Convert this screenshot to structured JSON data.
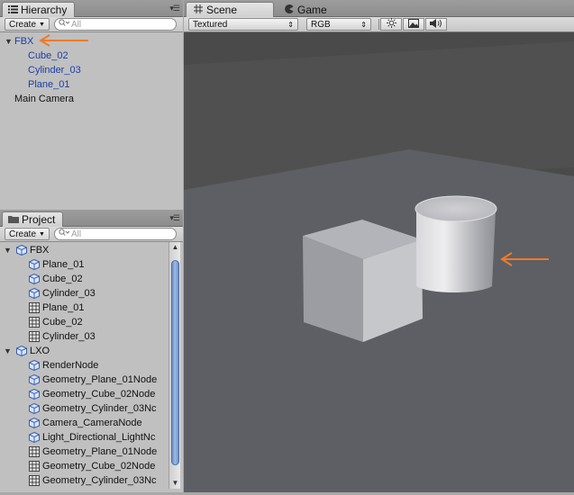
{
  "hierarchy": {
    "tab_label": "Hierarchy",
    "create_label": "Create",
    "search_placeholder": "All",
    "items": [
      {
        "label": "FBX",
        "indent": 0,
        "expanded": true,
        "color": "blue"
      },
      {
        "label": "Cube_02",
        "indent": 1,
        "color": "blue"
      },
      {
        "label": "Cylinder_03",
        "indent": 1,
        "color": "blue"
      },
      {
        "label": "Plane_01",
        "indent": 1,
        "color": "blue"
      },
      {
        "label": "Main Camera",
        "indent": 0,
        "color": "black"
      }
    ]
  },
  "project": {
    "tab_label": "Project",
    "create_label": "Create",
    "search_placeholder": "All",
    "items": [
      {
        "label": "FBX",
        "indent": 0,
        "icon": "prefab-icon",
        "folder": true
      },
      {
        "label": "Plane_01",
        "indent": 1,
        "icon": "prefab-icon"
      },
      {
        "label": "Cube_02",
        "indent": 1,
        "icon": "prefab-icon"
      },
      {
        "label": "Cylinder_03",
        "indent": 1,
        "icon": "prefab-icon"
      },
      {
        "label": "Plane_01",
        "indent": 1,
        "icon": "mesh-icon"
      },
      {
        "label": "Cube_02",
        "indent": 1,
        "icon": "mesh-icon"
      },
      {
        "label": "Cylinder_03",
        "indent": 1,
        "icon": "mesh-icon"
      },
      {
        "label": "LXO",
        "indent": 0,
        "icon": "prefab-icon",
        "folder": true
      },
      {
        "label": "RenderNode",
        "indent": 1,
        "icon": "prefab-icon"
      },
      {
        "label": "Geometry_Plane_01Node",
        "indent": 1,
        "icon": "prefab-icon"
      },
      {
        "label": "Geometry_Cube_02Node",
        "indent": 1,
        "icon": "prefab-icon"
      },
      {
        "label": "Geometry_Cylinder_03Nc",
        "indent": 1,
        "icon": "prefab-icon"
      },
      {
        "label": "Camera_CameraNode",
        "indent": 1,
        "icon": "prefab-icon"
      },
      {
        "label": "Light_Directional_LightNc",
        "indent": 1,
        "icon": "prefab-icon"
      },
      {
        "label": "Geometry_Plane_01Node",
        "indent": 1,
        "icon": "mesh-icon"
      },
      {
        "label": "Geometry_Cube_02Node",
        "indent": 1,
        "icon": "mesh-icon"
      },
      {
        "label": "Geometry_Cylinder_03Nc",
        "indent": 1,
        "icon": "mesh-icon"
      }
    ]
  },
  "scene": {
    "tab_scene": "Scene",
    "tab_game": "Game",
    "render_mode": "Textured",
    "color_mode": "RGB",
    "tools": [
      "sun-icon",
      "image-icon",
      "speaker-icon"
    ],
    "colors": {
      "sky": "#4a4a4a",
      "ground": "#5e5f64",
      "arrow": "#ef7a2a"
    }
  }
}
